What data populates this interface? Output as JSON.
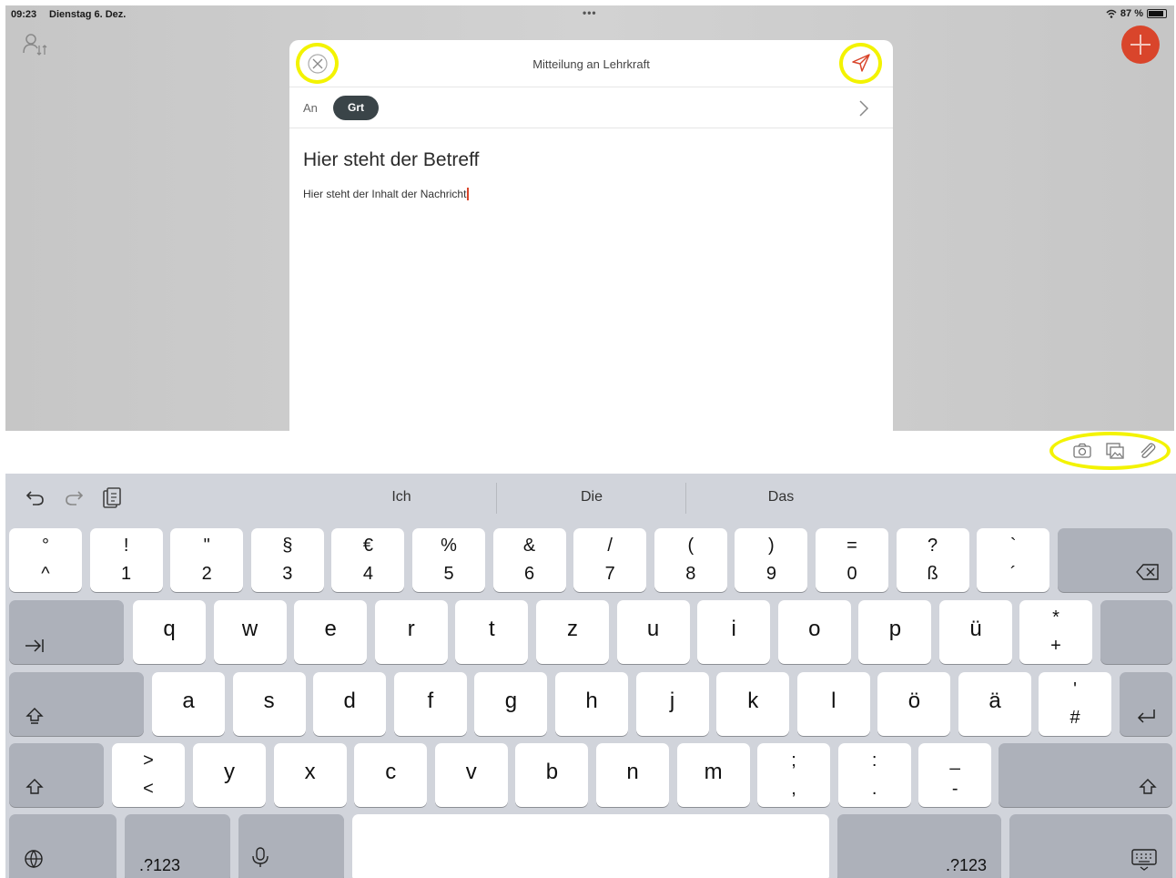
{
  "status_bar": {
    "time": "09:23",
    "date": "Dienstag 6. Dez.",
    "battery": "87 %"
  },
  "modal": {
    "title": "Mitteilung an Lehrkraft",
    "to_label": "An",
    "recipient_chip": "Grt",
    "subject": "Hier steht der Betreff",
    "body": "Hier steht der Inhalt der Nachricht"
  },
  "icons": {
    "background_left": "user-filter-icon",
    "fab": "plus-icon",
    "close": "close-icon",
    "send": "send-icon",
    "recipient_arrow": "chevron-right-icon",
    "attachments": [
      "camera-icon",
      "photo-library-icon",
      "paperclip-icon"
    ],
    "keyboard_tools": [
      "undo-icon",
      "redo-icon",
      "paste-icon"
    ],
    "keyboard_special": [
      "tab-icon",
      "caps-lock-icon",
      "shift-icon",
      "backspace-icon",
      "return-icon",
      "globe-icon",
      "microphone-icon",
      "hide-keyboard-icon"
    ]
  },
  "colors": {
    "accent": "#d9452b",
    "highlight": "#f3f300",
    "chip": "#3a4448",
    "keyboard_bg": "#d1d4db",
    "key_dark": "#adb1ba"
  },
  "keyboard": {
    "suggestions": [
      "Ich",
      "Die",
      "Das"
    ],
    "number_row": [
      {
        "upper": "°",
        "lower": "^"
      },
      {
        "upper": "!",
        "lower": "1"
      },
      {
        "upper": "\"",
        "lower": "2"
      },
      {
        "upper": "§",
        "lower": "3"
      },
      {
        "upper": "€",
        "lower": "4"
      },
      {
        "upper": "%",
        "lower": "5"
      },
      {
        "upper": "&",
        "lower": "6"
      },
      {
        "upper": "/",
        "lower": "7"
      },
      {
        "upper": "(",
        "lower": "8"
      },
      {
        "upper": ")",
        "lower": "9"
      },
      {
        "upper": "=",
        "lower": "0"
      },
      {
        "upper": "?",
        "lower": "ß"
      },
      {
        "upper": "`",
        "lower": "´"
      }
    ],
    "row_q": [
      "q",
      "w",
      "e",
      "r",
      "t",
      "z",
      "u",
      "i",
      "o",
      "p",
      "ü"
    ],
    "row_q_end": {
      "upper": "*",
      "lower": "+"
    },
    "row_a": [
      "a",
      "s",
      "d",
      "f",
      "g",
      "h",
      "j",
      "k",
      "l",
      "ö",
      "ä"
    ],
    "row_a_end": {
      "upper": "'",
      "lower": "#"
    },
    "row_y_start": {
      "upper": ">",
      "lower": "<"
    },
    "row_y": [
      "y",
      "x",
      "c",
      "v",
      "b",
      "n",
      "m"
    ],
    "row_y_end": [
      {
        "upper": ";",
        "lower": ","
      },
      {
        "upper": ":",
        "lower": "."
      },
      {
        "upper": "_",
        "lower": "-"
      }
    ],
    "numbers_label_left": ".?123",
    "numbers_label_right": ".?123"
  }
}
